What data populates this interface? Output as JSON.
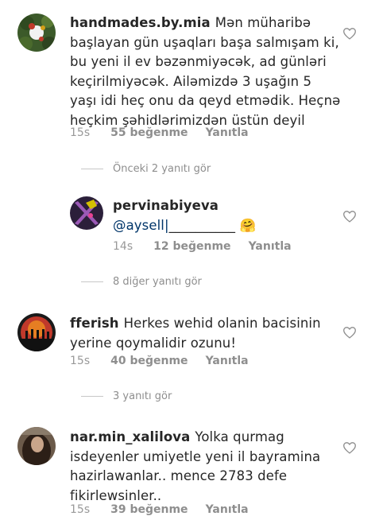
{
  "comments": [
    {
      "username": "handmades.by.mia",
      "lines": [
        "Mən müharibə",
        "başlayan gün uşaqları başa salmışam ki,",
        "bu yeni il ev bəzənmiyəcək, ad günləri",
        "keçirilmiyəcək. Ailəmizdə 3 uşağın 5",
        "yaşı idi heç onu da qeyd etmədik. Heçnə",
        "heçkim şəhidlərimizdən üstün deyil"
      ],
      "time": "15s",
      "likes": "55 beğenme",
      "reply": "Yanıtla"
    },
    {
      "username": "pervinabiyeva",
      "mention": "@aysell|",
      "underscores": "__________",
      "emoji": "🤗",
      "time": "14s",
      "likes": "12 beğenme",
      "reply": "Yanıtla"
    },
    {
      "username": "fferish",
      "lines": [
        "Herkes wehid olanin bacisinin",
        "yerine qoymalidir ozunu!"
      ],
      "time": "15s",
      "likes": "40 beğenme",
      "reply": "Yanıtla"
    },
    {
      "username": "nar.min_xalilova",
      "lines": [
        "Yolka qurmag",
        "isdeyenler umiyetle yeni il bayramina",
        "hazirlawanlar.. mence 2783 defe",
        "fikirlewsinler.."
      ],
      "time": "15s",
      "likes": "39 beğenme",
      "reply": "Yanıtla"
    }
  ],
  "view_replies": {
    "previous": "Önceki 2 yanıtı gör",
    "other": "8 diğer yanıtı gör",
    "three": "3 yanıtı gör"
  },
  "icons": {
    "like": "heart-outline-icon"
  },
  "colors": {
    "text": "#262626",
    "muted": "#8e8e8e",
    "mention": "#003569"
  }
}
